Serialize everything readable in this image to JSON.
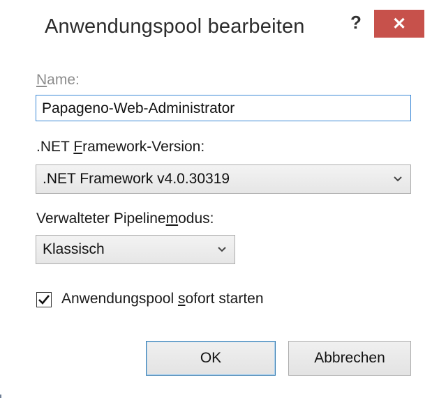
{
  "dialog": {
    "title": "Anwendungspool bearbeiten",
    "help_label": "?",
    "close_label": "✕"
  },
  "name": {
    "label_accel": "N",
    "label_rest": "ame:",
    "value": "Papageno-Web-Administrator"
  },
  "framework": {
    "label_pre": ".NET ",
    "label_accel": "F",
    "label_post": "ramework-Version:",
    "selected": ".NET Framework v4.0.30319"
  },
  "pipeline": {
    "label_pre": "Verwalteter Pipeline",
    "label_accel": "m",
    "label_post": "odus:",
    "selected": "Klassisch"
  },
  "start": {
    "checked": true,
    "label_pre": "Anwendungspool ",
    "label_accel": "s",
    "label_post": "ofort starten"
  },
  "buttons": {
    "ok": "OK",
    "cancel": "Abbrechen"
  },
  "icons": {
    "checkmark": "check-icon",
    "dropdown": "chevron-down-icon"
  }
}
